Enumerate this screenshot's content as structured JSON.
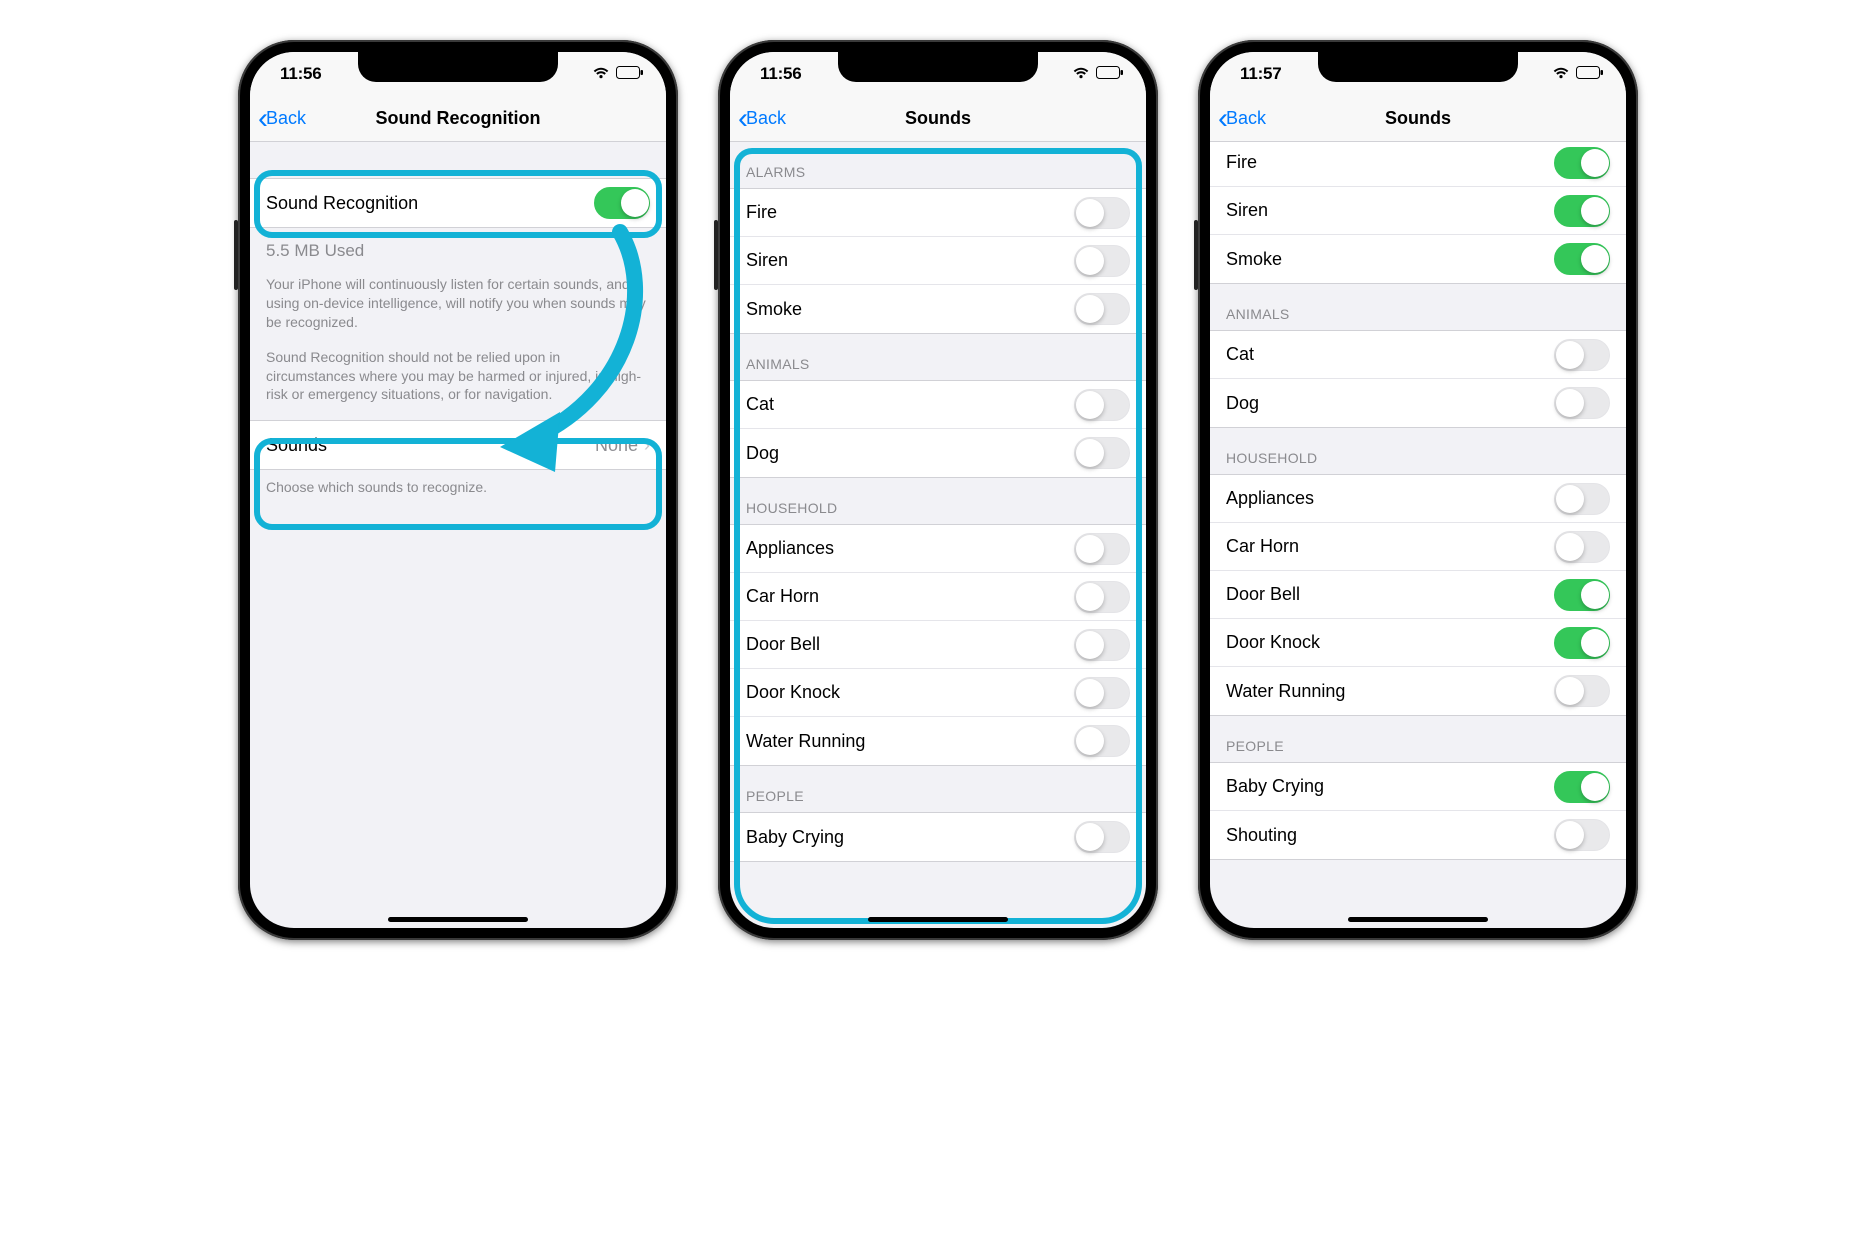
{
  "colors": {
    "highlight": "#13b2d6",
    "toggle_on": "#34c759",
    "link": "#007aff"
  },
  "statusbar": {
    "time1": "11:56",
    "time2": "11:56",
    "time3": "11:57"
  },
  "nav": {
    "back": "Back",
    "title1": "Sound Recognition",
    "title2": "Sounds",
    "title3": "Sounds"
  },
  "phone1": {
    "sound_recognition_label": "Sound Recognition",
    "sound_recognition_on": true,
    "storage": "5.5 MB Used",
    "desc1": "Your iPhone will continuously listen for certain sounds, and using on-device intelligence, will notify you when sounds may be recognized.",
    "desc2": "Sound Recognition should not be relied upon in circumstances where you may be harmed or injured, in high-risk or emergency situations, or for navigation.",
    "sounds_row_label": "Sounds",
    "sounds_row_value": "None",
    "choose_text": "Choose which sounds to recognize."
  },
  "sections": {
    "alarms": "ALARMS",
    "animals": "ANIMALS",
    "household": "HOUSEHOLD",
    "people": "PEOPLE"
  },
  "items": {
    "fire": "Fire",
    "siren": "Siren",
    "smoke": "Smoke",
    "cat": "Cat",
    "dog": "Dog",
    "appliances": "Appliances",
    "car_horn": "Car Horn",
    "door_bell": "Door Bell",
    "door_knock": "Door Knock",
    "water_running": "Water Running",
    "baby_crying": "Baby Crying",
    "shouting": "Shouting"
  },
  "phone2_states": {
    "fire": false,
    "siren": false,
    "smoke": false,
    "cat": false,
    "dog": false,
    "appliances": false,
    "car_horn": false,
    "door_bell": false,
    "door_knock": false,
    "water_running": false,
    "baby_crying": false
  },
  "phone3_states": {
    "fire": true,
    "siren": true,
    "smoke": true,
    "cat": false,
    "dog": false,
    "appliances": false,
    "car_horn": false,
    "door_bell": true,
    "door_knock": true,
    "water_running": false,
    "baby_crying": true,
    "shouting": false
  }
}
